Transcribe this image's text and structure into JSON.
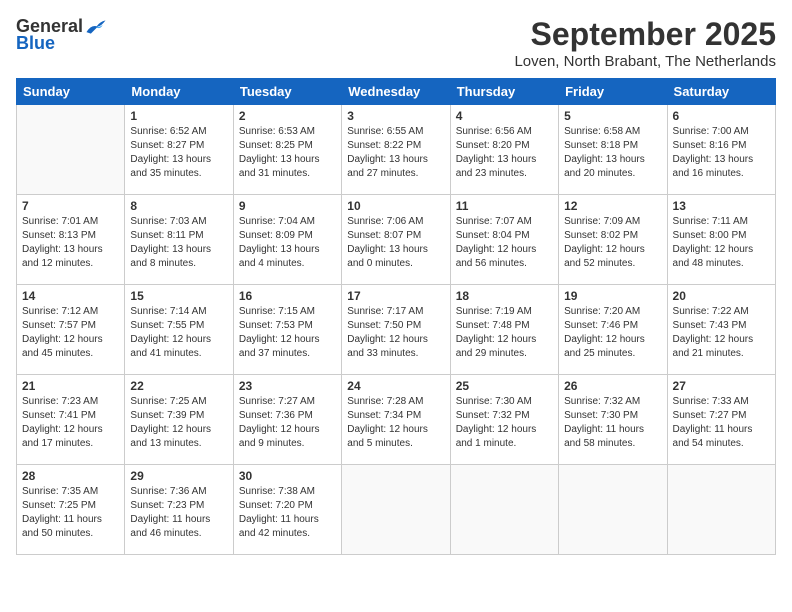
{
  "header": {
    "logo_general": "General",
    "logo_blue": "Blue",
    "month_title": "September 2025",
    "location": "Loven, North Brabant, The Netherlands"
  },
  "weekdays": [
    "Sunday",
    "Monday",
    "Tuesday",
    "Wednesday",
    "Thursday",
    "Friday",
    "Saturday"
  ],
  "weeks": [
    [
      {
        "day": "",
        "info": ""
      },
      {
        "day": "1",
        "info": "Sunrise: 6:52 AM\nSunset: 8:27 PM\nDaylight: 13 hours\nand 35 minutes."
      },
      {
        "day": "2",
        "info": "Sunrise: 6:53 AM\nSunset: 8:25 PM\nDaylight: 13 hours\nand 31 minutes."
      },
      {
        "day": "3",
        "info": "Sunrise: 6:55 AM\nSunset: 8:22 PM\nDaylight: 13 hours\nand 27 minutes."
      },
      {
        "day": "4",
        "info": "Sunrise: 6:56 AM\nSunset: 8:20 PM\nDaylight: 13 hours\nand 23 minutes."
      },
      {
        "day": "5",
        "info": "Sunrise: 6:58 AM\nSunset: 8:18 PM\nDaylight: 13 hours\nand 20 minutes."
      },
      {
        "day": "6",
        "info": "Sunrise: 7:00 AM\nSunset: 8:16 PM\nDaylight: 13 hours\nand 16 minutes."
      }
    ],
    [
      {
        "day": "7",
        "info": "Sunrise: 7:01 AM\nSunset: 8:13 PM\nDaylight: 13 hours\nand 12 minutes."
      },
      {
        "day": "8",
        "info": "Sunrise: 7:03 AM\nSunset: 8:11 PM\nDaylight: 13 hours\nand 8 minutes."
      },
      {
        "day": "9",
        "info": "Sunrise: 7:04 AM\nSunset: 8:09 PM\nDaylight: 13 hours\nand 4 minutes."
      },
      {
        "day": "10",
        "info": "Sunrise: 7:06 AM\nSunset: 8:07 PM\nDaylight: 13 hours\nand 0 minutes."
      },
      {
        "day": "11",
        "info": "Sunrise: 7:07 AM\nSunset: 8:04 PM\nDaylight: 12 hours\nand 56 minutes."
      },
      {
        "day": "12",
        "info": "Sunrise: 7:09 AM\nSunset: 8:02 PM\nDaylight: 12 hours\nand 52 minutes."
      },
      {
        "day": "13",
        "info": "Sunrise: 7:11 AM\nSunset: 8:00 PM\nDaylight: 12 hours\nand 48 minutes."
      }
    ],
    [
      {
        "day": "14",
        "info": "Sunrise: 7:12 AM\nSunset: 7:57 PM\nDaylight: 12 hours\nand 45 minutes."
      },
      {
        "day": "15",
        "info": "Sunrise: 7:14 AM\nSunset: 7:55 PM\nDaylight: 12 hours\nand 41 minutes."
      },
      {
        "day": "16",
        "info": "Sunrise: 7:15 AM\nSunset: 7:53 PM\nDaylight: 12 hours\nand 37 minutes."
      },
      {
        "day": "17",
        "info": "Sunrise: 7:17 AM\nSunset: 7:50 PM\nDaylight: 12 hours\nand 33 minutes."
      },
      {
        "day": "18",
        "info": "Sunrise: 7:19 AM\nSunset: 7:48 PM\nDaylight: 12 hours\nand 29 minutes."
      },
      {
        "day": "19",
        "info": "Sunrise: 7:20 AM\nSunset: 7:46 PM\nDaylight: 12 hours\nand 25 minutes."
      },
      {
        "day": "20",
        "info": "Sunrise: 7:22 AM\nSunset: 7:43 PM\nDaylight: 12 hours\nand 21 minutes."
      }
    ],
    [
      {
        "day": "21",
        "info": "Sunrise: 7:23 AM\nSunset: 7:41 PM\nDaylight: 12 hours\nand 17 minutes."
      },
      {
        "day": "22",
        "info": "Sunrise: 7:25 AM\nSunset: 7:39 PM\nDaylight: 12 hours\nand 13 minutes."
      },
      {
        "day": "23",
        "info": "Sunrise: 7:27 AM\nSunset: 7:36 PM\nDaylight: 12 hours\nand 9 minutes."
      },
      {
        "day": "24",
        "info": "Sunrise: 7:28 AM\nSunset: 7:34 PM\nDaylight: 12 hours\nand 5 minutes."
      },
      {
        "day": "25",
        "info": "Sunrise: 7:30 AM\nSunset: 7:32 PM\nDaylight: 12 hours\nand 1 minute."
      },
      {
        "day": "26",
        "info": "Sunrise: 7:32 AM\nSunset: 7:30 PM\nDaylight: 11 hours\nand 58 minutes."
      },
      {
        "day": "27",
        "info": "Sunrise: 7:33 AM\nSunset: 7:27 PM\nDaylight: 11 hours\nand 54 minutes."
      }
    ],
    [
      {
        "day": "28",
        "info": "Sunrise: 7:35 AM\nSunset: 7:25 PM\nDaylight: 11 hours\nand 50 minutes."
      },
      {
        "day": "29",
        "info": "Sunrise: 7:36 AM\nSunset: 7:23 PM\nDaylight: 11 hours\nand 46 minutes."
      },
      {
        "day": "30",
        "info": "Sunrise: 7:38 AM\nSunset: 7:20 PM\nDaylight: 11 hours\nand 42 minutes."
      },
      {
        "day": "",
        "info": ""
      },
      {
        "day": "",
        "info": ""
      },
      {
        "day": "",
        "info": ""
      },
      {
        "day": "",
        "info": ""
      }
    ]
  ]
}
